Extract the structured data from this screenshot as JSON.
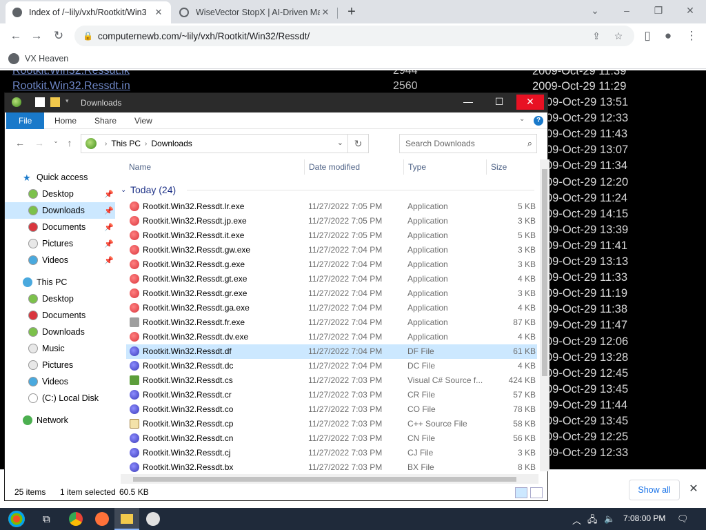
{
  "browser": {
    "tabs": [
      {
        "title": "Index of /~lily/vxh/Rootkit/Win3",
        "active": true
      },
      {
        "title": "WiseVector StopX | AI-Driven Ma",
        "active": false
      }
    ],
    "url": "computernewb.com/~lily/vxh/Rootkit/Win32/Ressdt/",
    "bookmark": "VX Heaven"
  },
  "page": {
    "rows": [
      {
        "name": "Rootkit.Win32.Ressdt.lk",
        "size": "2944",
        "date": "2009-Oct-29 11:39"
      },
      {
        "name": "Rootkit.Win32.Ressdt.in",
        "size": "2560",
        "date": "2009-Oct-29 11:29"
      }
    ],
    "visible_dates": [
      "09-Oct-29 13:51",
      "09-Oct-29 12:33",
      "09-Oct-29 11:43",
      "09-Oct-29 13:07",
      "09-Oct-29 11:34",
      "09-Oct-29 12:20",
      "09-Oct-29 11:24",
      "09-Oct-29 14:15",
      "09-Oct-29 13:39",
      "09-Oct-29 11:41",
      "09-Oct-29 13:13",
      "09-Oct-29 11:33",
      "09-Oct-29 11:19",
      "09-Oct-29 11:38",
      "09-Oct-29 11:47",
      "09-Oct-29 12:06",
      "09-Oct-29 13:28",
      "09-Oct-29 12:45",
      "09-Oct-29 13:45",
      "09-Oct-29 11:44",
      "09-Oct-29 13:45",
      "09-Oct-29 12:25",
      "09-Oct-29 12:33"
    ]
  },
  "downloads_bar": {
    "show_all": "Show all"
  },
  "explorer": {
    "title": "Downloads",
    "ribbon_tabs": [
      "File",
      "Home",
      "Share",
      "View"
    ],
    "address": {
      "root": "This PC",
      "folder": "Downloads"
    },
    "search_placeholder": "Search Downloads",
    "nav": {
      "quick_access": "Quick access",
      "quick_items": [
        "Desktop",
        "Downloads",
        "Documents",
        "Pictures",
        "Videos"
      ],
      "this_pc": "This PC",
      "pc_items": [
        "Desktop",
        "Documents",
        "Downloads",
        "Music",
        "Pictures",
        "Videos",
        "(C:) Local Disk"
      ],
      "network": "Network"
    },
    "columns": {
      "name": "Name",
      "date": "Date modified",
      "type": "Type",
      "size": "Size"
    },
    "group": "Today (24)",
    "files": [
      {
        "name": "Rootkit.Win32.Ressdt.lr.exe",
        "date": "11/27/2022 7:05 PM",
        "type": "Application",
        "size": "5 KB",
        "icon": "exe-icon"
      },
      {
        "name": "Rootkit.Win32.Ressdt.jp.exe",
        "date": "11/27/2022 7:05 PM",
        "type": "Application",
        "size": "3 KB",
        "icon": "exe-icon"
      },
      {
        "name": "Rootkit.Win32.Ressdt.it.exe",
        "date": "11/27/2022 7:05 PM",
        "type": "Application",
        "size": "5 KB",
        "icon": "exe-icon"
      },
      {
        "name": "Rootkit.Win32.Ressdt.gw.exe",
        "date": "11/27/2022 7:04 PM",
        "type": "Application",
        "size": "3 KB",
        "icon": "exe-icon"
      },
      {
        "name": "Rootkit.Win32.Ressdt.g.exe",
        "date": "11/27/2022 7:04 PM",
        "type": "Application",
        "size": "3 KB",
        "icon": "exe-icon"
      },
      {
        "name": "Rootkit.Win32.Ressdt.gt.exe",
        "date": "11/27/2022 7:04 PM",
        "type": "Application",
        "size": "4 KB",
        "icon": "exe-icon"
      },
      {
        "name": "Rootkit.Win32.Ressdt.gr.exe",
        "date": "11/27/2022 7:04 PM",
        "type": "Application",
        "size": "3 KB",
        "icon": "exe-icon"
      },
      {
        "name": "Rootkit.Win32.Ressdt.ga.exe",
        "date": "11/27/2022 7:04 PM",
        "type": "Application",
        "size": "4 KB",
        "icon": "exe-icon"
      },
      {
        "name": "Rootkit.Win32.Ressdt.fr.exe",
        "date": "11/27/2022 7:04 PM",
        "type": "Application",
        "size": "87 KB",
        "icon": "app-window-icon"
      },
      {
        "name": "Rootkit.Win32.Ressdt.dv.exe",
        "date": "11/27/2022 7:04 PM",
        "type": "Application",
        "size": "4 KB",
        "icon": "exe-icon"
      },
      {
        "name": "Rootkit.Win32.Ressdt.df",
        "date": "11/27/2022 7:04 PM",
        "type": "DF File",
        "size": "61 KB",
        "icon": "generic-file-icon",
        "selected": true
      },
      {
        "name": "Rootkit.Win32.Ressdt.dc",
        "date": "11/27/2022 7:04 PM",
        "type": "DC File",
        "size": "4 KB",
        "icon": "generic-file-icon"
      },
      {
        "name": "Rootkit.Win32.Ressdt.cs",
        "date": "11/27/2022 7:03 PM",
        "type": "Visual C# Source f...",
        "size": "424 KB",
        "icon": "csharp-file-icon"
      },
      {
        "name": "Rootkit.Win32.Ressdt.cr",
        "date": "11/27/2022 7:03 PM",
        "type": "CR File",
        "size": "57 KB",
        "icon": "generic-file-icon"
      },
      {
        "name": "Rootkit.Win32.Ressdt.co",
        "date": "11/27/2022 7:03 PM",
        "type": "CO File",
        "size": "78 KB",
        "icon": "generic-file-icon"
      },
      {
        "name": "Rootkit.Win32.Ressdt.cp",
        "date": "11/27/2022 7:03 PM",
        "type": "C++ Source File",
        "size": "58 KB",
        "icon": "cpp-file-icon"
      },
      {
        "name": "Rootkit.Win32.Ressdt.cn",
        "date": "11/27/2022 7:03 PM",
        "type": "CN File",
        "size": "56 KB",
        "icon": "generic-file-icon"
      },
      {
        "name": "Rootkit.Win32.Ressdt.cj",
        "date": "11/27/2022 7:03 PM",
        "type": "CJ File",
        "size": "3 KB",
        "icon": "generic-file-icon"
      },
      {
        "name": "Rootkit.Win32.Ressdt.bx",
        "date": "11/27/2022 7:03 PM",
        "type": "BX File",
        "size": "8 KB",
        "icon": "generic-file-icon"
      }
    ],
    "status": {
      "items": "25 items",
      "selected": "1 item selected",
      "size": "60.5 KB"
    }
  },
  "taskbar": {
    "time": "7:08:00 PM"
  },
  "colors": {
    "selection": "#cce8ff",
    "file_tab": "#1979ca",
    "close_red": "#e81123",
    "exe_red": "#d9363e",
    "generic_blue": "#3b3bb8"
  }
}
